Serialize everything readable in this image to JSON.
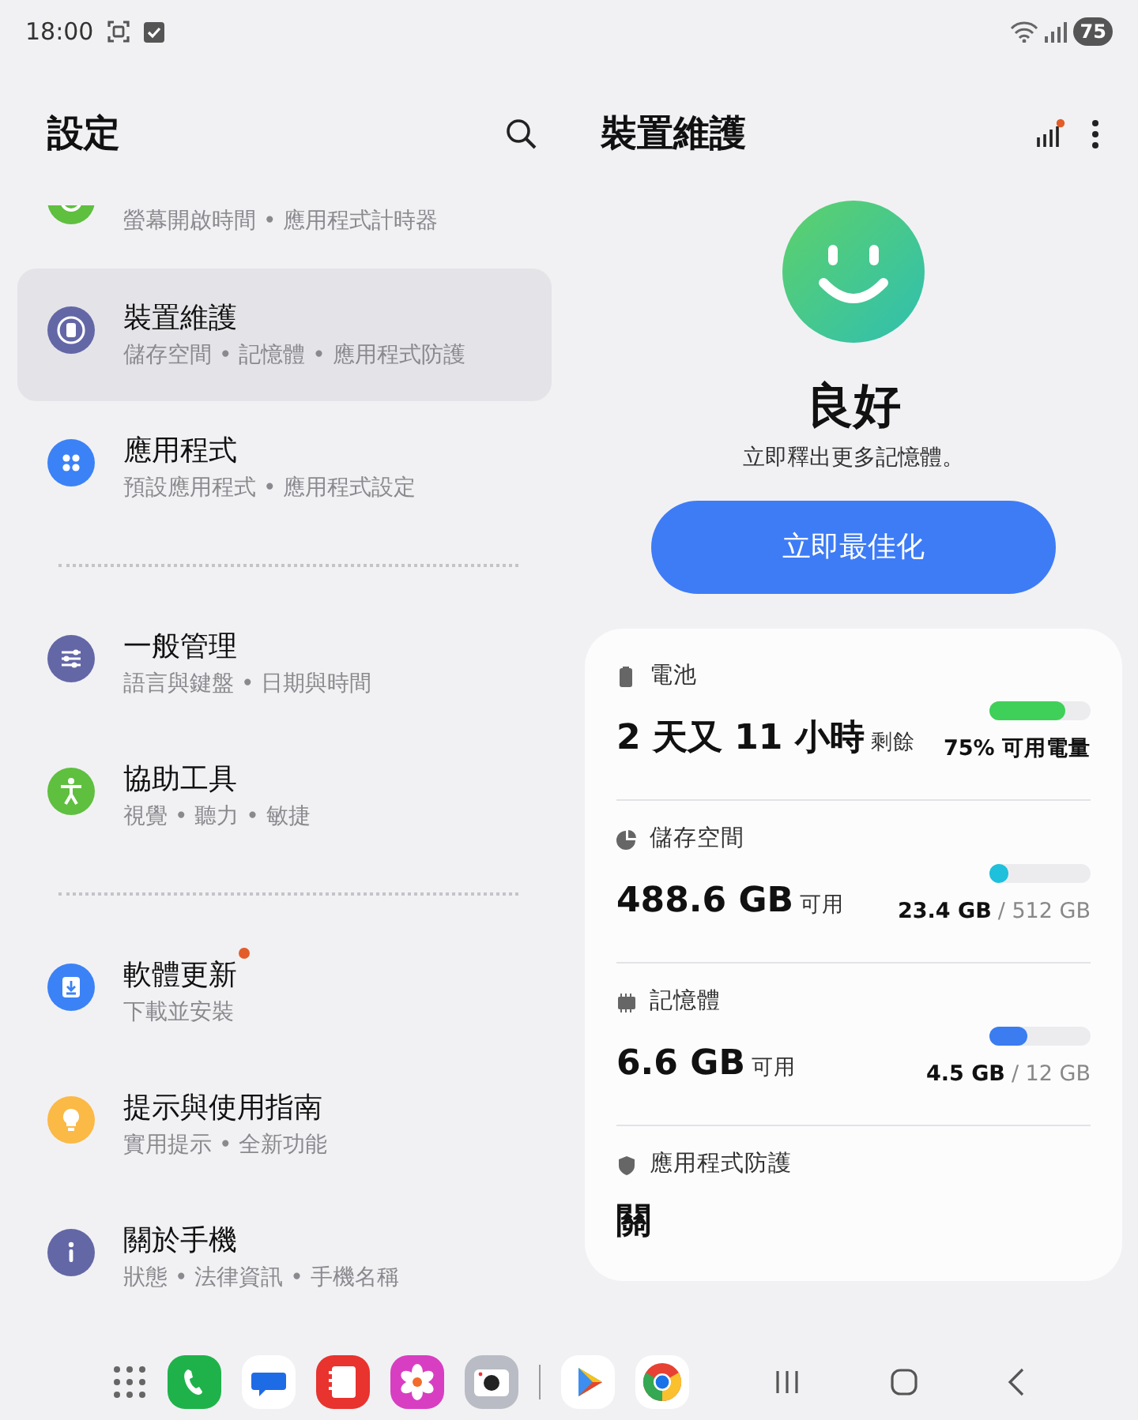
{
  "status_bar": {
    "time": "18:00",
    "battery": "75"
  },
  "settings": {
    "title": "設定",
    "items": [
      {
        "kind": "item",
        "subtitle": "螢幕開啟時間 • 應用程式計時器",
        "color": "#5fbf3f",
        "selected": false,
        "badge": false
      },
      {
        "kind": "item",
        "title": "裝置維護",
        "subtitle": "儲存空間 • 記憶體 • 應用程式防護",
        "color": "#6367a6",
        "selected": true,
        "badge": false
      },
      {
        "kind": "item",
        "title": "應用程式",
        "subtitle": "預設應用程式 • 應用程式設定",
        "color": "#3b82f6",
        "selected": false,
        "badge": false
      },
      {
        "kind": "divider"
      },
      {
        "kind": "item",
        "title": "一般管理",
        "subtitle": "語言與鍵盤 • 日期與時間",
        "color": "#6367a6",
        "selected": false,
        "badge": false
      },
      {
        "kind": "item",
        "title": "協助工具",
        "subtitle": "視覺 • 聽力 • 敏捷",
        "color": "#5fbf3f",
        "selected": false,
        "badge": false
      },
      {
        "kind": "divider"
      },
      {
        "kind": "item",
        "title": "軟體更新",
        "subtitle": "下載並安裝",
        "color": "#3b82f6",
        "selected": false,
        "badge": true
      },
      {
        "kind": "item",
        "title": "提示與使用指南",
        "subtitle": "實用提示 • 全新功能",
        "color": "#fbb945",
        "selected": false,
        "badge": false
      },
      {
        "kind": "item",
        "title": "關於手機",
        "subtitle": "狀態 • 法律資訊 • 手機名稱",
        "color": "#6367a6",
        "selected": false,
        "badge": false
      }
    ]
  },
  "device_care": {
    "title": "裝置維護",
    "status": "良好",
    "message": "立即釋出更多記憶體。",
    "button": "立即最佳化",
    "sections": [
      {
        "kind": "meter",
        "label": "電池",
        "value": "2 天又 11 小時",
        "suffix": "剩餘",
        "level": 0.75,
        "color": "#3fd05a",
        "detail_strong": "75% 可用電量"
      },
      {
        "kind": "meter",
        "label": "儲存空間",
        "value": "488.6 GB",
        "suffix": "可用",
        "level": 0.05,
        "color": "#1ec0db",
        "detail_strong": "23.4 GB",
        "detail_muted": "/ 512 GB"
      },
      {
        "kind": "meter",
        "label": "記憶體",
        "value": "6.6 GB",
        "suffix": "可用",
        "level": 0.375,
        "color": "#3b7cf0",
        "detail_strong": "4.5 GB",
        "detail_muted": "/ 12 GB"
      },
      {
        "kind": "plain",
        "label": "應用程式防護",
        "value": "關"
      }
    ]
  }
}
